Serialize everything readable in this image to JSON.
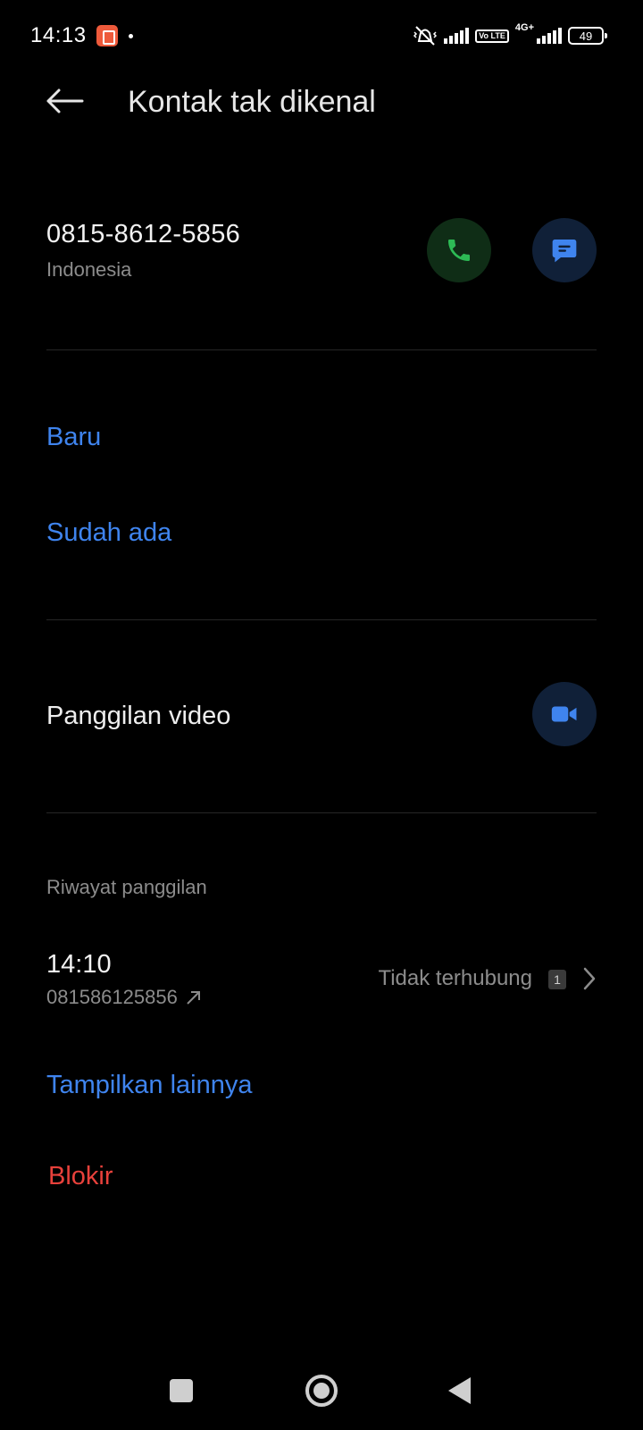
{
  "status_bar": {
    "time": "14:13",
    "network": "4G+",
    "volte": "Vo LTE",
    "battery": "49"
  },
  "header": {
    "title": "Kontak tak dikenal"
  },
  "contact": {
    "number": "0815-8612-5856",
    "country": "Indonesia"
  },
  "add_contact": {
    "new_label": "Baru",
    "existing_label": "Sudah ada"
  },
  "video_call": {
    "label": "Panggilan video"
  },
  "call_history": {
    "section_label": "Riwayat panggilan",
    "entries": [
      {
        "time": "14:10",
        "number": "081586125856",
        "status": "Tidak terhubung",
        "count": "1"
      }
    ],
    "show_more_label": "Tampilkan lainnya"
  },
  "block_label": "Blokir",
  "colors": {
    "accent_blue": "#3f84ee",
    "call_green": "#2dbb55",
    "danger_red": "#e8413b",
    "background": "#000000"
  }
}
